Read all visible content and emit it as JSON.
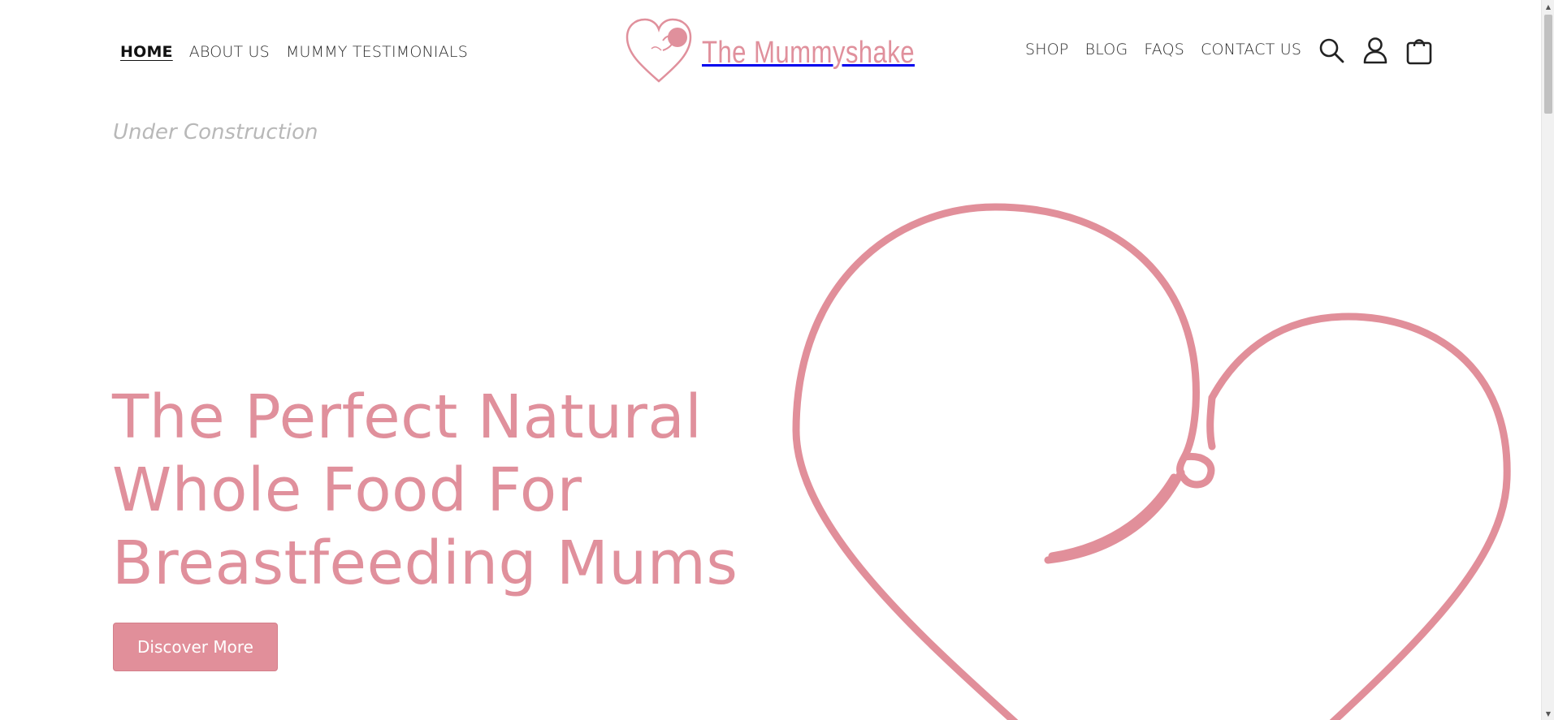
{
  "header": {
    "nav_left": [
      {
        "label": "HOME",
        "active": true
      },
      {
        "label": "ABOUT US"
      },
      {
        "label": "MUMMY TESTIMONIALS"
      }
    ],
    "logo_text": "The Mummyshake",
    "nav_right": [
      {
        "label": "SHOP"
      },
      {
        "label": "BLOG"
      },
      {
        "label": "FAQS"
      },
      {
        "label": "CONTACT US"
      }
    ],
    "icons": [
      "search-icon",
      "account-icon",
      "cart-icon"
    ]
  },
  "banner": {
    "notice": "Under Construction"
  },
  "hero": {
    "lines": [
      "The Perfect Natural",
      "Whole Food For",
      "Breastfeeding Mums"
    ],
    "cta_label": "Discover More"
  },
  "colors": {
    "brand_pink": "#e0909c",
    "text_dark": "#2b2b2b",
    "muted": "#b8b8b8"
  },
  "scrollbar": {
    "up_glyph": "▲",
    "down_glyph": "▼"
  }
}
